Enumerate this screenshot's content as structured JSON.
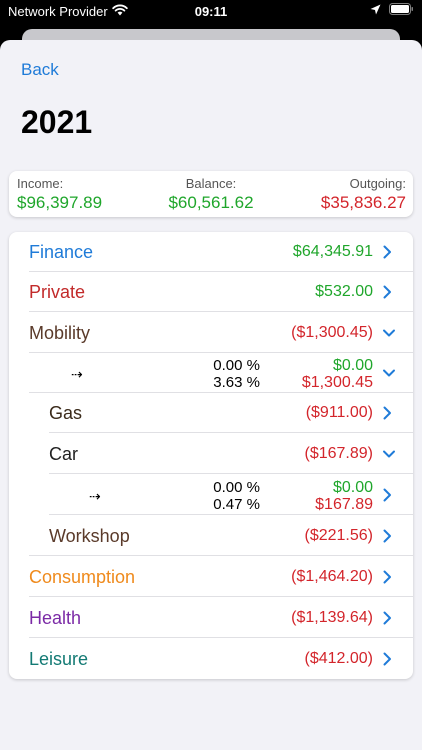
{
  "status": {
    "carrier": "Network Provider",
    "time": "09:11"
  },
  "nav": {
    "back_label": "Back"
  },
  "title": "2021",
  "summary": {
    "income_label": "Income:",
    "income_value": "$96,397.89",
    "balance_label": "Balance:",
    "balance_value": "$60,561.62",
    "outgoing_label": "Outgoing:",
    "outgoing_value": "$35,836.27"
  },
  "rows": [
    {
      "label": "Finance",
      "amount": "$64,345.91",
      "color": "#1f7bd8",
      "amount_color": "green",
      "chevron": "right"
    },
    {
      "label": "Private",
      "amount": "$532.00",
      "color": "#c22a2a",
      "amount_color": "green",
      "chevron": "right"
    },
    {
      "label": "Mobility",
      "amount": "($1,300.45)",
      "color": "#5a3a2a",
      "amount_color": "red",
      "chevron": "down"
    },
    {
      "arrow": "⇢",
      "pct_in": "0.00 %",
      "pct_out": "3.63 %",
      "val_in": "$0.00",
      "val_out": "$1,300.45",
      "chevron": "down"
    },
    {
      "label": "Gas",
      "amount": "($911.00)",
      "color": "#3a2a1a",
      "amount_color": "red",
      "chevron": "right"
    },
    {
      "label": "Car",
      "amount": "($167.89)",
      "color": "#222",
      "amount_color": "red",
      "chevron": "down"
    },
    {
      "arrow": "⇢",
      "pct_in": "0.00 %",
      "pct_out": "0.47 %",
      "val_in": "$0.00",
      "val_out": "$167.89",
      "chevron": "right"
    },
    {
      "label": "Workshop",
      "amount": "($221.56)",
      "color": "#5a3a2a",
      "amount_color": "red",
      "chevron": "right"
    },
    {
      "label": "Consumption",
      "amount": "($1,464.20)",
      "color": "#ef8a1c",
      "amount_color": "red",
      "chevron": "right"
    },
    {
      "label": "Health",
      "amount": "($1,139.64)",
      "color": "#7b2aa6",
      "amount_color": "red",
      "chevron": "right"
    },
    {
      "label": "Leisure",
      "amount": "($412.00)",
      "color": "#137a74",
      "amount_color": "red",
      "chevron": "right"
    }
  ],
  "icons": {
    "wifi": "wifi-icon",
    "location": "location-arrow-icon",
    "battery": "battery-icon",
    "chevron_right": "chevron-right-icon",
    "chevron_down": "chevron-down-icon"
  },
  "colors": {
    "accent": "#1f7bd8",
    "positive": "#1fa62b",
    "negative": "#d3252b"
  }
}
